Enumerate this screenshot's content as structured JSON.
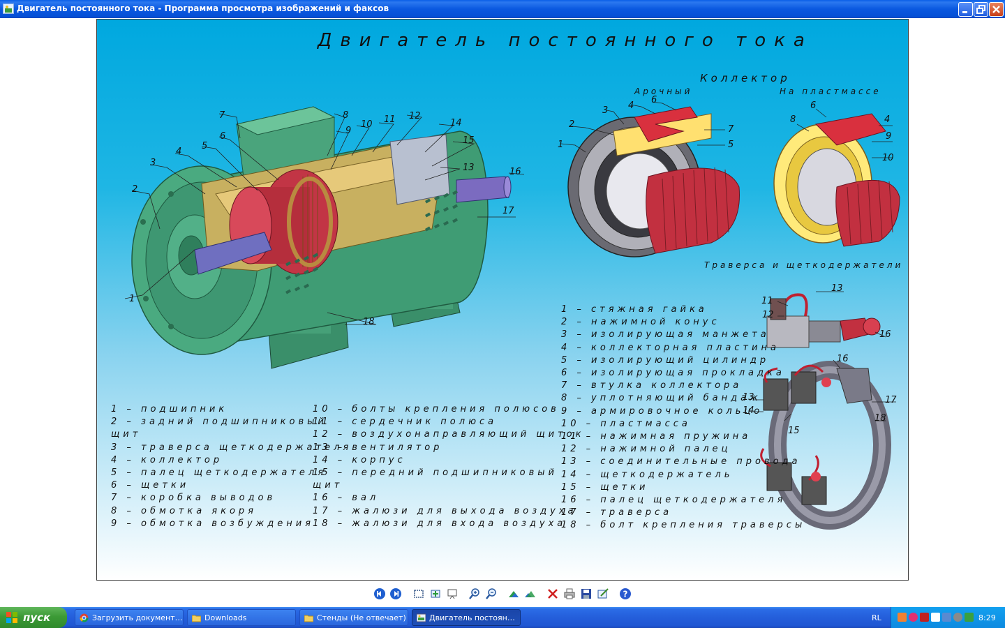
{
  "window": {
    "title": "Двигатель постоянного тока - Программа просмотра изображений и факсов",
    "buttons": {
      "minimize": "minimize-icon",
      "maximize": "restore-icon",
      "close": "close-icon"
    }
  },
  "poster": {
    "title": "Двигатель постоянного тока",
    "collector_heading": "Коллектор",
    "collector_arched": "Арочный",
    "collector_plastic": "На пластмассе",
    "traverse_heading": "Траверса и щеткодержатели",
    "legend_left_col1": [
      "1 – подшипник",
      "2 – задний подшипниковый",
      "щит",
      "3 – траверса щеткодержателя",
      "4 – коллектор",
      "5 – палец щеткодержателя",
      "6 – щетки",
      "7 – коробка выводов",
      "8 – обмотка якоря",
      "9 – обмотка возбуждения"
    ],
    "legend_left_col2": [
      "10 – болты крепления полюсов",
      "11 – сердечник полюса",
      "12 – воздухонаправляющий щиток",
      "13 – вентилятор",
      "14 – корпус",
      "15 – передний подшипниковый",
      "щит",
      "16 – вал",
      "17 – жалюзи для выхода воздуха",
      "18 – жалюзи для входа воздуха"
    ],
    "legend_right": [
      "1 – стяжная гайка",
      "2 – нажимной конус",
      "3 – изолирующая манжета",
      "4 – коллекторная пластина",
      "5 – изолирующий цилиндр",
      "6 – изолирующая прокладка",
      "7 – втулка коллектора",
      "8 – уплотняющий бандаж",
      "9 – армировочное кольцо",
      "10 – пластмасса",
      "11 – нажимная пружина",
      "12 – нажимной палец",
      "13 – соединительные провода",
      "14 – щеткодержатель",
      "15 – щетки",
      "16 – палец щеткодержателя",
      "17 – траверса",
      "18 – болт крепления траверсы"
    ],
    "motor_callouts": [
      "1",
      "2",
      "3",
      "4",
      "5",
      "6",
      "7",
      "8",
      "9",
      "10",
      "11",
      "12",
      "14",
      "15",
      "13",
      "16",
      "17",
      "18"
    ],
    "arched_callouts": [
      "1",
      "2",
      "3",
      "4",
      "6",
      "7",
      "5"
    ],
    "plastic_callouts": [
      "8",
      "6",
      "4",
      "9",
      "10"
    ],
    "brush_top_callouts": [
      "11",
      "13",
      "12",
      "16"
    ],
    "traverse_callouts": [
      "16",
      "13",
      "14",
      "17",
      "18",
      "15"
    ]
  },
  "toolbar": {
    "icons": [
      "previous-image-icon",
      "next-image-icon",
      "best-fit-icon",
      "actual-size-icon",
      "slideshow-icon",
      "zoom-in-icon",
      "zoom-out-icon",
      "rotate-clockwise-icon",
      "rotate-counterclockwise-icon",
      "delete-icon",
      "print-icon",
      "save-icon",
      "edit-icon",
      "help-icon"
    ]
  },
  "taskbar": {
    "start_label": "пуск",
    "tasks": [
      {
        "label": "Загрузить документ…",
        "icon": "chrome-icon"
      },
      {
        "label": "Downloads",
        "icon": "folder-icon"
      },
      {
        "label": "Стенды (Не отвечает)",
        "icon": "folder-icon"
      },
      {
        "label": "Двигатель постоян…",
        "icon": "image-viewer-icon"
      }
    ],
    "language": "RL",
    "clock": "8:29"
  }
}
